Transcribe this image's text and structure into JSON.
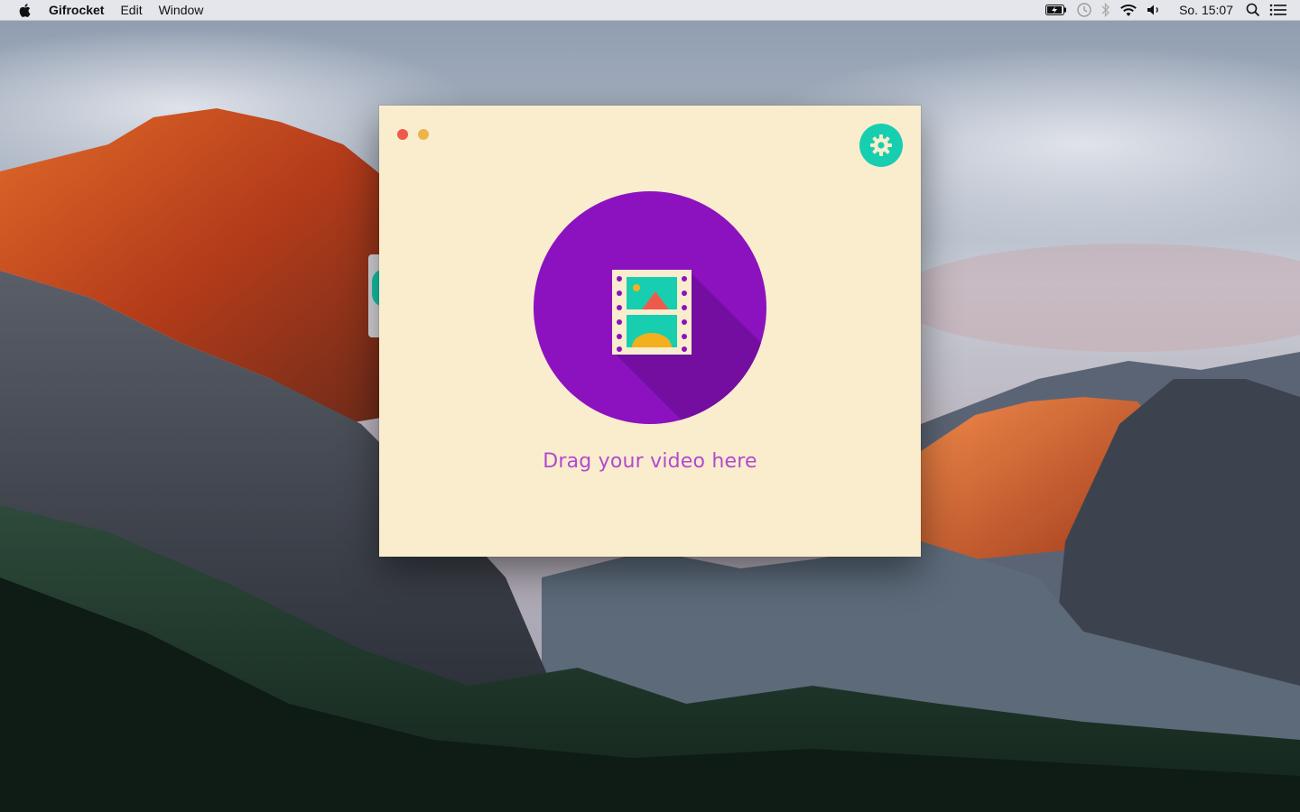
{
  "menubar": {
    "app_name": "Gifrocket",
    "items": [
      "Edit",
      "Window"
    ],
    "clock": "So. 15:07",
    "status_icons": [
      "battery-charging-icon",
      "time-machine-icon",
      "bluetooth-icon",
      "wifi-icon",
      "volume-icon",
      "spotlight-search-icon",
      "notification-center-icon"
    ]
  },
  "window": {
    "background_color": "#faedcd",
    "accent_teal": "#17cfb0",
    "accent_purple": "#8c12bf",
    "drop_text": "Drag your video here"
  }
}
